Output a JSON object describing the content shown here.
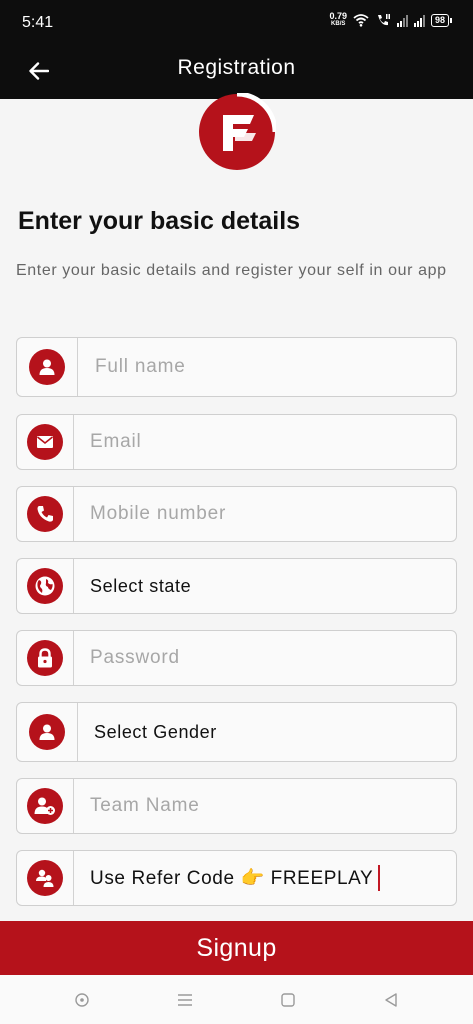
{
  "status_bar": {
    "time": "5:41",
    "net_speed": "0.79",
    "net_unit": "KB/S",
    "battery": "98"
  },
  "app_bar": {
    "title": "Registration",
    "back_icon": "arrow-left-icon"
  },
  "page": {
    "heading": "Enter your basic details",
    "subtitle": "Enter your basic details and register your self in our app"
  },
  "form": {
    "full_name": {
      "placeholder": "Full name",
      "value": "",
      "icon": "person-icon"
    },
    "email": {
      "placeholder": "Email",
      "value": "",
      "icon": "mail-icon"
    },
    "mobile": {
      "placeholder": "Mobile number",
      "value": "",
      "icon": "phone-icon"
    },
    "state": {
      "value": "Select state",
      "icon": "globe-icon"
    },
    "password": {
      "placeholder": "Password",
      "value": "",
      "icon": "lock-icon"
    },
    "gender": {
      "value": "Select Gender",
      "icon": "person-icon"
    },
    "team_name": {
      "placeholder": "Team Name",
      "value": "",
      "icon": "person-add-icon"
    },
    "refer_code": {
      "value": "Use Refer Code 👉 FREEPLAY",
      "icon": "group-icon"
    }
  },
  "signup_label": "Signup",
  "colors": {
    "accent": "#b5121b",
    "header_bg": "#0d0d0d",
    "page_bg": "#f5f5f5"
  },
  "nav_bar": {
    "icons": [
      "circle-home-icon",
      "menu-icon",
      "square-icon",
      "back-triangle-icon"
    ]
  }
}
